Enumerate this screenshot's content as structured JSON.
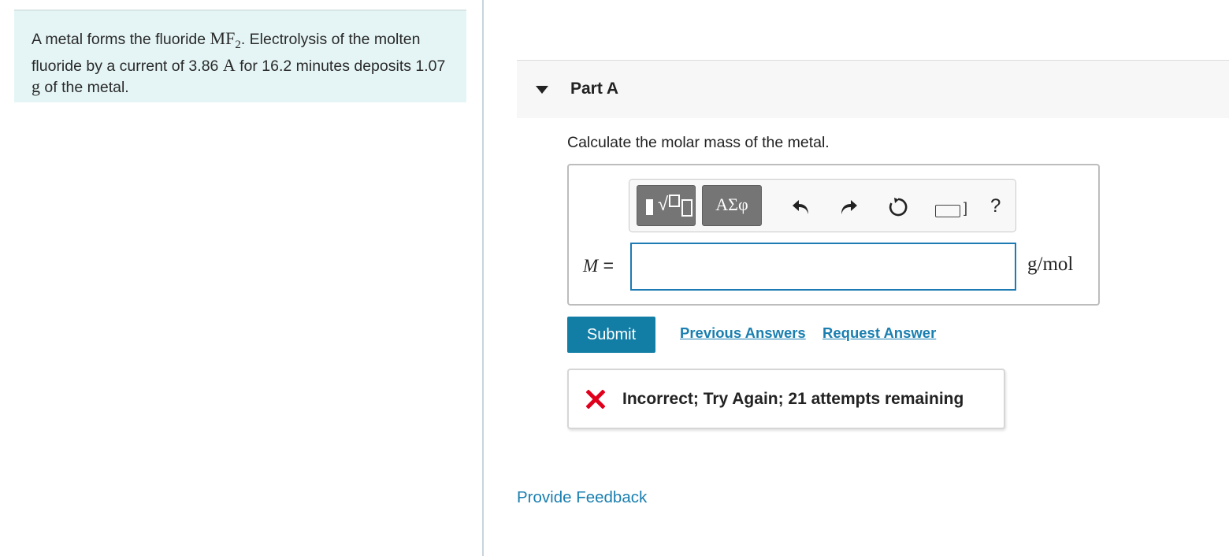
{
  "problem": {
    "t1": "A metal forms the fluoride ",
    "formula_base": "MF",
    "formula_sub": "2",
    "t2": ". Electrolysis of the molten fluoride by a current of 3.86 ",
    "unit_current": "A",
    "t3": " for 16.2 minutes deposits 1.07 ",
    "unit_mass": "g",
    "t4": " of the metal."
  },
  "part": {
    "title": "Part A",
    "question": "Calculate the molar mass of the metal."
  },
  "toolbar": {
    "symbols_label": "ΑΣφ",
    "help_label": "?"
  },
  "answer": {
    "variable": "M",
    "equals": "=",
    "value": "",
    "unit": "g/mol"
  },
  "actions": {
    "submit_label": "Submit",
    "previous_answers_label": "Previous Answers",
    "request_answer_label": "Request Answer"
  },
  "feedback": {
    "message": "Incorrect; Try Again; 21 attempts remaining",
    "status_color": "#e0001b"
  },
  "footer": {
    "provide_feedback_label": "Provide Feedback"
  }
}
